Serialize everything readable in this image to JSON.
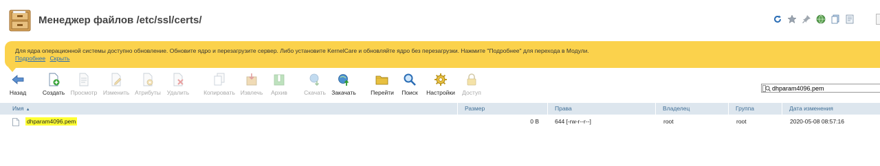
{
  "header": {
    "title": "Менеджер файлов /etc/ssl/certs/",
    "icons": [
      "refresh-icon",
      "star-icon",
      "pin-icon",
      "globe-icon",
      "copy-icon",
      "note-icon"
    ]
  },
  "notice": {
    "text": "Для ядра операционной системы доступно обновление. Обновите ядро и перезагрузите сервер. Либо установите KernelCare и обновляйте ядро без перезагрузки. Нажмите \"Подробнее\" для перехода в Модули.",
    "details_link": "Подробнее",
    "hide_link": "Скрыть",
    "color": "#fbd24c"
  },
  "toolbar": {
    "back": "Назад",
    "create": "Создать",
    "view": "Просмотр",
    "edit": "Изменить",
    "attributes": "Атрибуты",
    "delete": "Удалить",
    "copy": "Копировать",
    "extract": "Извлечь",
    "archive": "Архив",
    "download": "Скачать",
    "upload": "Закачать",
    "goto": "Перейти",
    "search": "Поиск",
    "settings": "Настройки",
    "access": "Доступ"
  },
  "search": {
    "value": "dhparam4096.pem"
  },
  "table": {
    "columns": {
      "name": "Имя",
      "size": "Размер",
      "rights": "Права",
      "owner": "Владелец",
      "group": "Группа",
      "modified": "Дата изменения"
    },
    "rows": [
      {
        "name": "dhparam4096.pem",
        "size": "0 B",
        "rights": "644 [-rw-r--r--]",
        "owner": "root",
        "group": "root",
        "modified": "2020-05-08 08:57:16"
      }
    ]
  },
  "colors": {
    "header_bg": "#dde6ee",
    "header_text": "#3f6e96",
    "highlight": "#ffff33"
  }
}
